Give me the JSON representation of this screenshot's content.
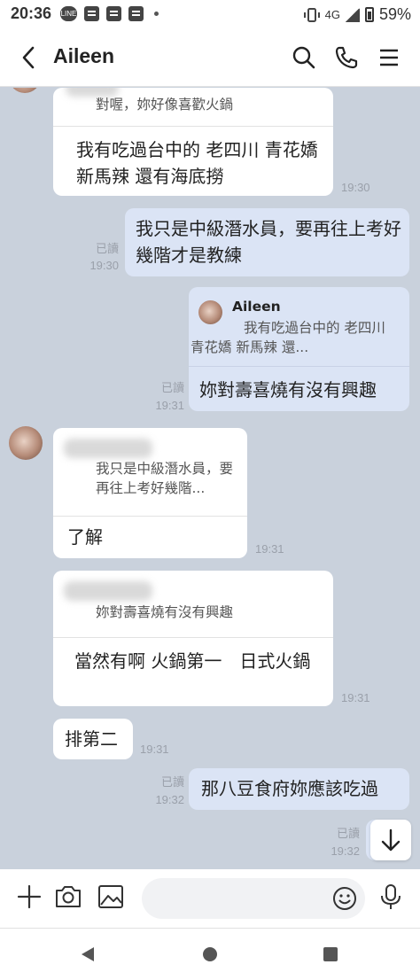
{
  "status_bar": {
    "time": "20:36",
    "network": "4G",
    "battery": "59%",
    "line_icon_text": "LINE"
  },
  "header": {
    "title": "Aileen"
  },
  "messages": {
    "m1": {
      "quote_text": "對喔，妳好像喜歡火鍋",
      "text": "我有吃過台中的 老四川 青花嬌 新馬辣 還有海底撈",
      "time": "19:30"
    },
    "m2": {
      "text": "我只是中級潛水員，要再往上考好幾階才是教練",
      "read": "已讀",
      "time": "19:30"
    },
    "m3": {
      "quote_name": "Aileen",
      "quote_text": "我有吃過台中的 老四川 青花嬌 新馬辣 還...",
      "text": "妳對壽喜燒有沒有興趣",
      "read": "已讀",
      "time": "19:31"
    },
    "m4": {
      "quote_text": "我只是中級潛水員，要再往上考好幾階...",
      "text": "了解",
      "time": "19:31"
    },
    "m5": {
      "quote_text": "妳對壽喜燒有沒有興趣",
      "text": "當然有啊 火鍋第一　日式火鍋",
      "time": "19:31"
    },
    "m6": {
      "text": "排第二",
      "time": "19:31"
    },
    "m7": {
      "text": "那八豆食府妳應該吃過",
      "read": "已讀",
      "time": "19:32"
    },
    "m8": {
      "read": "已讀",
      "time": "19:32"
    }
  },
  "input": {
    "placeholder": ""
  },
  "colors": {
    "chat_bg": "#c9d1dc",
    "my_bubble": "#dbe4f5",
    "their_bubble": "#ffffff"
  }
}
